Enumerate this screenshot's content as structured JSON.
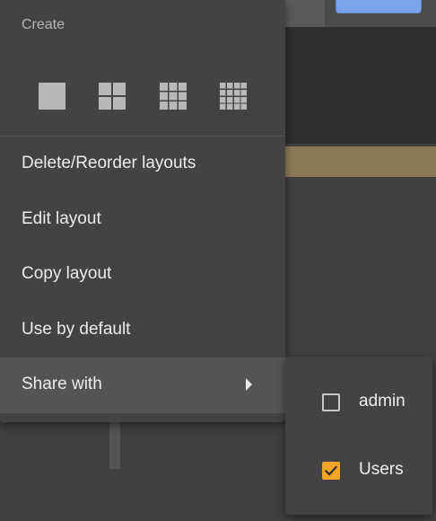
{
  "layouts_menu": {
    "create_title": "Create",
    "grid_options": [
      {
        "name": "1x1",
        "icon": "grid-1x1-icon",
        "cells": 1
      },
      {
        "name": "2x2",
        "icon": "grid-2x2-icon",
        "cells": 2
      },
      {
        "name": "3x3",
        "icon": "grid-3x3-icon",
        "cells": 3
      },
      {
        "name": "4x4",
        "icon": "grid-4x4-icon",
        "cells": 4
      }
    ],
    "items": [
      {
        "label": "Delete/Reorder layouts"
      },
      {
        "label": "Edit layout"
      },
      {
        "label": "Copy layout"
      },
      {
        "label": "Use by default"
      },
      {
        "label": "Share with",
        "has_submenu": true,
        "active": true
      }
    ]
  },
  "share_menu": {
    "options": [
      {
        "label": "admin",
        "checked": false
      },
      {
        "label": "Users",
        "checked": true
      }
    ]
  },
  "colors": {
    "menu_bg": "#434343",
    "active_item_bg": "#545454",
    "checkbox_checked": "#f2a527",
    "icon_fill": "#b8b8b8",
    "accent_blue": "#7aa3ea",
    "gold_band": "#8a7a55"
  }
}
